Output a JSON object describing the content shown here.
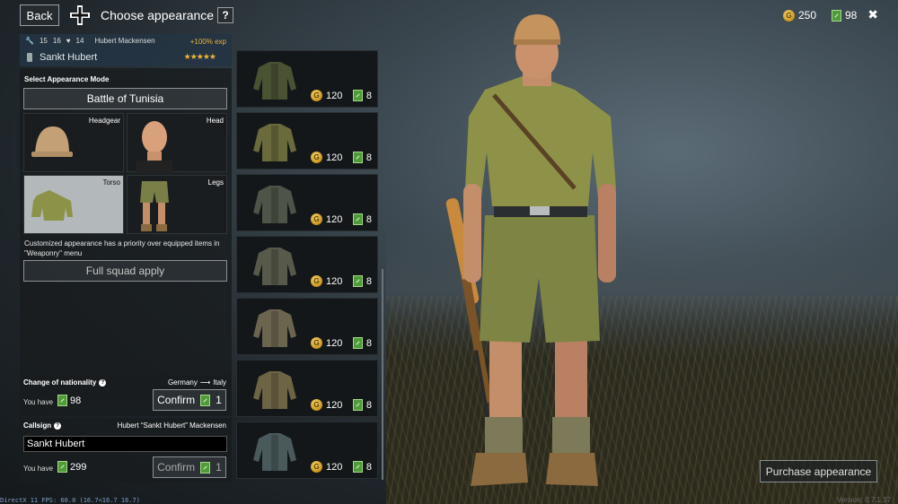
{
  "topbar": {
    "back_label": "Back",
    "title": "Choose appearance",
    "help_label": "?",
    "silver": "250",
    "tickets": "98",
    "close_label": "✖",
    "nation_icon": "iron-cross-icon"
  },
  "soldier": {
    "stats": [
      "15",
      "16",
      "14"
    ],
    "name_full": "Hubert Mackensen",
    "exp_bonus": "+100% exp",
    "callsign_display": "Sankt Hubert",
    "stars": "★★★★★"
  },
  "appearance": {
    "mode_label": "Select Appearance Mode",
    "mode_value": "Battle of Tunisia",
    "slots": {
      "headgear": "Headgear",
      "head": "Head",
      "torso": "Torso",
      "legs": "Legs"
    },
    "note": "Customized appearance has a priority over equipped items in \"Weaponry\" menu",
    "squad_apply_label": "Full squad apply"
  },
  "nationality": {
    "title": "Change of nationality",
    "from": "Germany",
    "to": "Italy",
    "you_have_label": "You have",
    "tickets": "98",
    "confirm_label": "Confirm",
    "cost": "1"
  },
  "callsign": {
    "title": "Callsign",
    "full_name": "Hubert “Sankt Hubert” Mackensen",
    "input_value": "Sankt Hubert",
    "you_have_label": "You have",
    "tickets": "299",
    "confirm_label": "Confirm",
    "cost": "1"
  },
  "items": [
    {
      "price": "120",
      "tickets": "8",
      "color": "#4a5234"
    },
    {
      "price": "120",
      "tickets": "8",
      "color": "#6a6a3c"
    },
    {
      "price": "120",
      "tickets": "8",
      "color": "#4e5448"
    },
    {
      "price": "120",
      "tickets": "8",
      "color": "#575a4a"
    },
    {
      "price": "120",
      "tickets": "8",
      "color": "#6b6550"
    },
    {
      "price": "120",
      "tickets": "8",
      "color": "#6d6446"
    },
    {
      "price": "120",
      "tickets": "8",
      "color": "#4a5a5c"
    }
  ],
  "purchase_label": "Purchase appearance",
  "fps_text": "DirectX 11 FPS: 60.0 (16.7<16.7 16.7)",
  "version_text": "Version: 0.7.1.37"
}
